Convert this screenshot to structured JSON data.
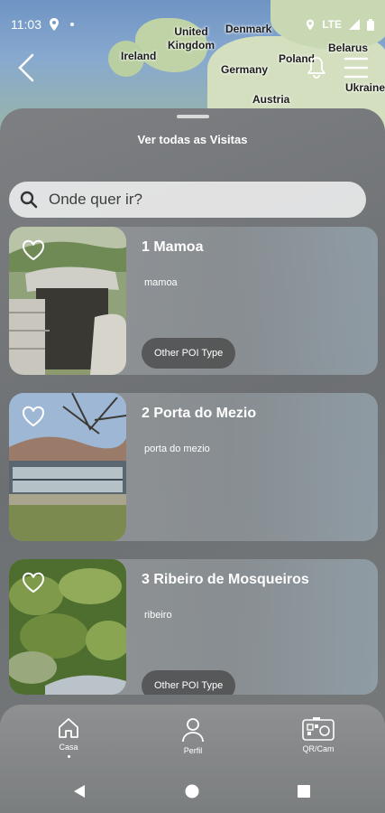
{
  "status_bar": {
    "time": "11:03",
    "network": "LTE"
  },
  "map": {
    "labels": [
      {
        "id": "ireland",
        "text": "Ireland"
      },
      {
        "id": "uk",
        "text": "United\nKingdom"
      },
      {
        "id": "denmark",
        "text": "Denmark"
      },
      {
        "id": "belarus",
        "text": "Belarus"
      },
      {
        "id": "poland",
        "text": "Poland"
      },
      {
        "id": "germany",
        "text": "Germany"
      },
      {
        "id": "ukraine",
        "text": "Ukraine"
      },
      {
        "id": "austria",
        "text": "Austria"
      }
    ]
  },
  "sheet": {
    "title": "Ver todas as Visitas",
    "search_placeholder": "Onde quer ir?"
  },
  "cards": [
    {
      "title": "1 Mamoa",
      "description": "mamoa",
      "badge": "Other POI Type"
    },
    {
      "title": "2 Porta do Mezio",
      "description": "porta do mezio",
      "badge": ""
    },
    {
      "title": "3 Ribeiro de Mosqueiros",
      "description": "ribeiro",
      "badge": "Other POI Type"
    }
  ],
  "bottom_nav": {
    "home": "Casa",
    "profile": "Perfil",
    "qr": "QR/Cam"
  },
  "icons": {
    "back": "chevron-left-icon",
    "bell": "bell-icon",
    "menu": "hamburger-icon",
    "search": "search-icon",
    "heart": "heart-outline-icon",
    "home": "home-icon",
    "profile": "user-icon",
    "qr": "qr-camera-icon"
  },
  "colors": {
    "sheet": "#6d7073",
    "card": "#929598",
    "badge": "#464646"
  }
}
